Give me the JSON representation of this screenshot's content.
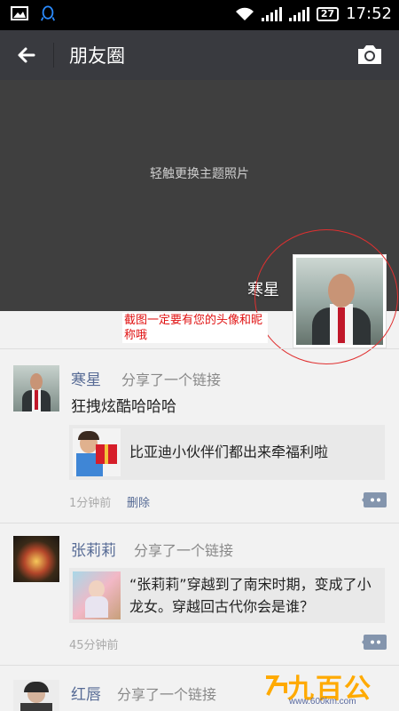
{
  "status_bar": {
    "time": "17:52",
    "battery": "27"
  },
  "action_bar": {
    "title": "朋友圈"
  },
  "cover": {
    "hint": "轻触更换主题照片",
    "user_name": "寒星"
  },
  "annotation": {
    "text": "截图一定要有您的头像和昵称哦"
  },
  "posts": [
    {
      "name": "寒星",
      "action": "分享了一个链接",
      "text": "狂拽炫酷哈哈哈",
      "link_title": "比亚迪小伙伴们都出来牵福利啦",
      "time": "1分钟前",
      "delete_label": "删除"
    },
    {
      "name": "张莉莉",
      "action": "分享了一个链接",
      "link_title": "“张莉莉”穿越到了南宋时期，变成了小龙女。穿越回古代你会是谁？",
      "time": "45分钟前"
    },
    {
      "name": "红唇",
      "action": "分享了一个链接"
    }
  ],
  "watermark": {
    "brand": "九百公里",
    "url": "www.600km.com"
  },
  "colors": {
    "action_bar": "#393a3f",
    "name_link": "#576b95",
    "annotation": "#e01010"
  }
}
